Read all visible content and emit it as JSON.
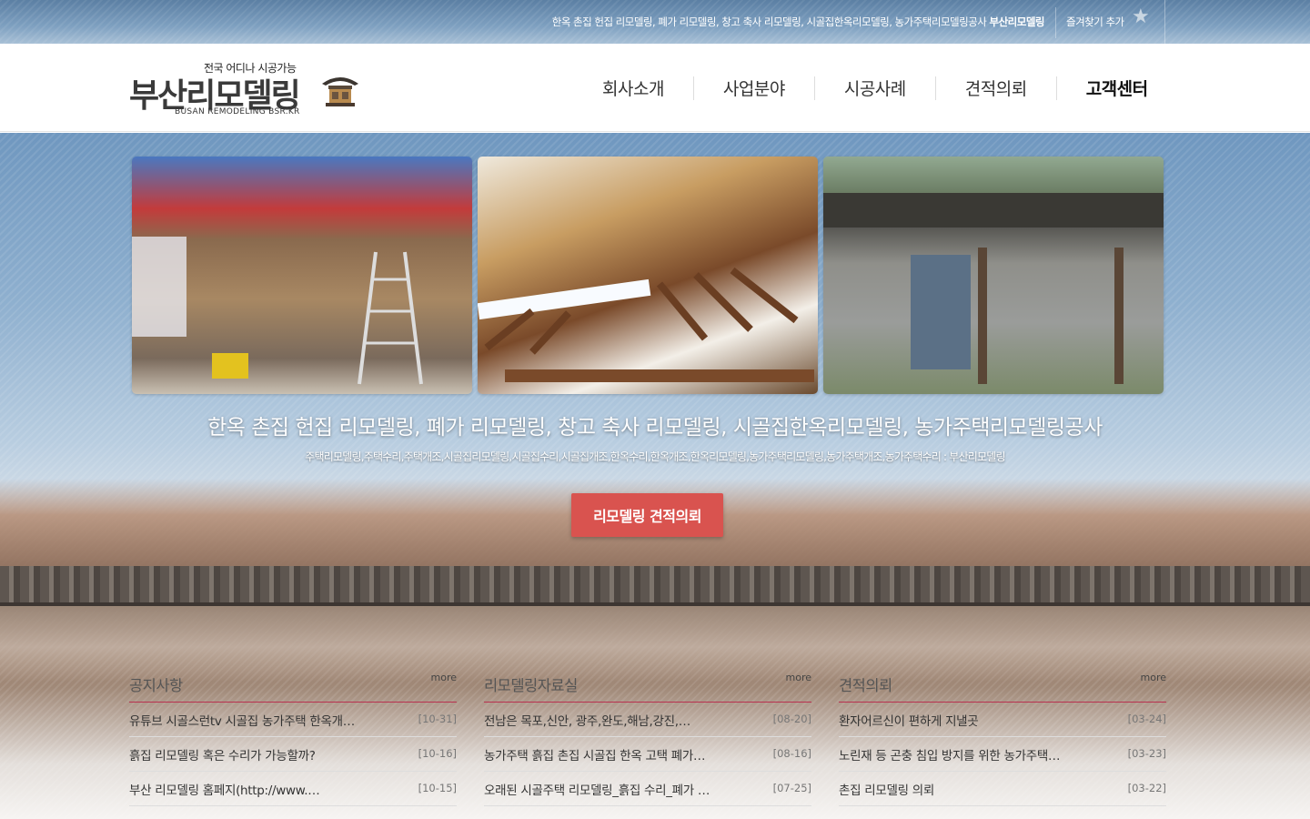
{
  "topbar": {
    "tagline": "한옥 촌집 헌집 리모델링, 폐가 리모델링, 창고 축사 리모델링, 시골집한옥리모델링, 농가주택리모델링공사",
    "brand": "부산리모델링",
    "favorite_label": "즐겨찾기 추가",
    "favorite_icon": "star-icon"
  },
  "logo": {
    "tagline": "전국 어디나 시공가능",
    "name": "부산리모델링",
    "english": "BUSAN REMODELING   BSR.KR"
  },
  "nav": {
    "items": [
      {
        "label": "회사소개"
      },
      {
        "label": "사업분야"
      },
      {
        "label": "시공사례"
      },
      {
        "label": "견적의뢰"
      },
      {
        "label": "고객센터"
      }
    ],
    "active_index": 4
  },
  "hero": {
    "title": "한옥 촌집 헌집 리모델링, 폐가 리모델링, 창고 축사 리모델링, 시골집한옥리모델링, 농가주택리모델링공사",
    "subtitle": "주택리모델링,주택수리,주택개조,시골집리모델링,시골집수리,시골집개조,한옥수리,한옥개조,한옥리모델링,농가주택리모델링,농가주택개조,농가주택수리 : 부산리모델링",
    "cta_label": "리모델링 견적의뢰",
    "cta_color": "#d9534f"
  },
  "boards": [
    {
      "title": "공지사항",
      "more": "more",
      "rows": [
        {
          "title": "유튜브 시골스런tv 시골집 농가주택 한옥개…",
          "date": "[10-31]"
        },
        {
          "title": "흙집 리모델링 혹은 수리가 가능할까?",
          "date": "[10-16]"
        },
        {
          "title": "부산 리모델링 홈페지(http://www.…",
          "date": "[10-15]"
        }
      ]
    },
    {
      "title": "리모델링자료실",
      "more": "more",
      "rows": [
        {
          "title": "전남은 목포,신안, 광주,완도,해남,강진,…",
          "date": "[08-20]"
        },
        {
          "title": "농가주택 흙집 촌집 시골집 한옥 고택 폐가…",
          "date": "[08-16]"
        },
        {
          "title": "오래된 시골주택 리모델링_흙집 수리_폐가 …",
          "date": "[07-25]"
        }
      ]
    },
    {
      "title": "견적의뢰",
      "more": "more",
      "rows": [
        {
          "title": "환자어르신이 편하게 지낼곳",
          "date": "[03-24]"
        },
        {
          "title": "노린재 등 곤충 침입 방지를 위한 농가주택…",
          "date": "[03-23]"
        },
        {
          "title": "촌집 리모델링 의뢰",
          "date": "[03-22]"
        }
      ]
    }
  ],
  "colors": {
    "accent": "#b9314f",
    "cta": "#d9534f"
  }
}
